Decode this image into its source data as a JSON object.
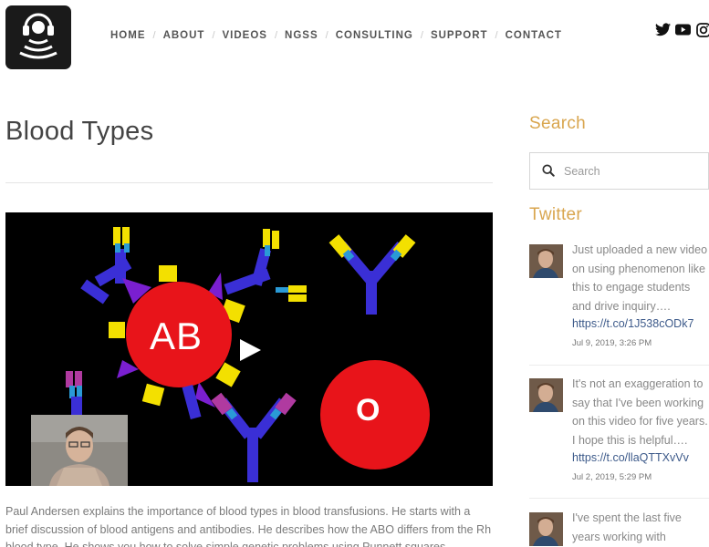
{
  "header": {
    "logo_name": "headphones-logo",
    "nav": [
      "HOME",
      "ABOUT",
      "VIDEOS",
      "NGSS",
      "CONSULTING",
      "SUPPORT",
      "CONTACT"
    ],
    "social_icons": [
      "twitter-icon",
      "youtube-icon",
      "instagram-icon"
    ]
  },
  "main": {
    "title": "Blood Types",
    "video": {
      "ab_label": "AB",
      "o_label": "O",
      "play_icon": "play-icon"
    },
    "description": "Paul Andersen explains the importance of blood types in blood transfusions. He starts with a brief discussion of blood antigens and antibodies. He describes how the ABO differs from the Rh blood type. He shows you how to solve simple genetic problems using Punnett squares."
  },
  "sidebar": {
    "search_heading": "Search",
    "search_placeholder": "Search",
    "twitter_heading": "Twitter",
    "tweets": [
      {
        "text": "Just uploaded a new video on using phenomenon like this to engage students and drive inquiry….",
        "link": "https://t.co/1J538cODk7",
        "date": "Jul 9, 2019, 3:26 PM"
      },
      {
        "text": "It's not an exaggeration to say that I've been working on this video for five years. I hope this is helpful….",
        "link": "https://t.co/llaQTTXvVv",
        "date": "Jul 2, 2019, 5:29 PM"
      },
      {
        "text": "I've spent the last five years working with",
        "link": "",
        "date": ""
      }
    ]
  },
  "colors": {
    "accent_gold": "#d9a64f",
    "link_blue": "#3d5a8a",
    "blood_red": "#e8141a",
    "antibody_blue": "#3a2fd6",
    "antigen_yellow": "#f3e000"
  }
}
